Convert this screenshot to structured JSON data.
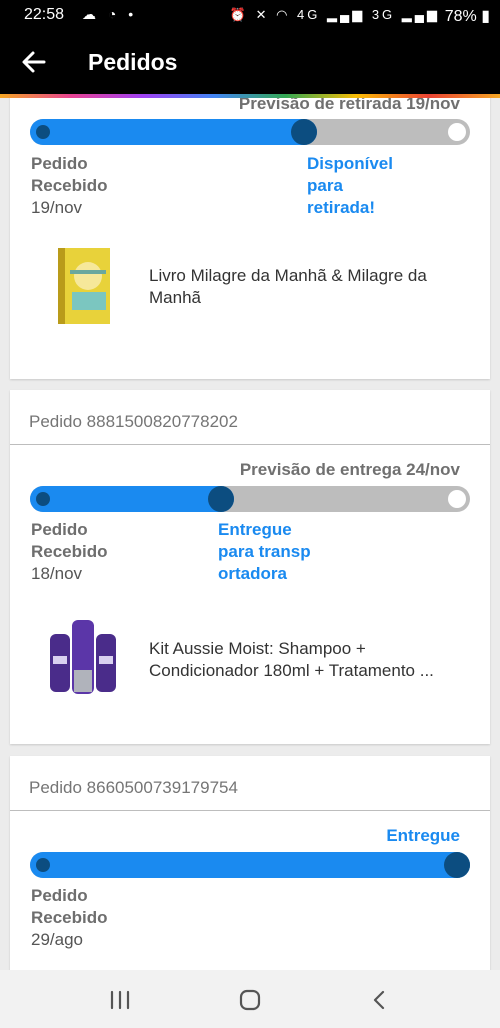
{
  "status_bar": {
    "time": "22:58",
    "left_icons": "☁ ◔ •",
    "right_icons": "⏰ ✕ ◠ 4G ▂▄▆ 3G ▂▄▆",
    "battery": "78%",
    "icon_names": [
      "data-saver-icon",
      "cloud-icon",
      "whatsapp-icon",
      "dot-icon",
      "alarm-icon",
      "mute-icon",
      "wifi-icon",
      "signal-4g-icon",
      "signal-3g-icon",
      "battery-icon"
    ]
  },
  "app_bar": {
    "title": "Pedidos",
    "back_icon": "arrow-left-icon"
  },
  "colors": {
    "accent": "#1a8af0",
    "track_done": "#1a8af0",
    "track_pending": "#bdbdbd",
    "dot": "#0c4d80",
    "app_bar": "#000000"
  },
  "orders": [
    {
      "estimate": "Previsão de retirada 19/nov",
      "progress": 0.63,
      "step_received": "Pedido Recebido",
      "step_date": "19/nov",
      "status": "Disponível para retirada!",
      "product": "Livro Milagre da Manhã & Milagre da Manhã"
    },
    {
      "order_id": "Pedido 8881500820778202",
      "estimate": "Previsão de entrega 24/nov",
      "progress": 0.43,
      "step_received": "Pedido Recebido",
      "step_date": "18/nov",
      "status": "Entregue para transp ortadora",
      "product": "Kit Aussie Moist: Shampoo + Condicionador 180ml + Tratamento ..."
    },
    {
      "order_id": "Pedido 8660500739179754",
      "estimate": "Entregue",
      "progress": 1.0,
      "step_received": "Pedido Recebido",
      "step_date": "29/ago"
    }
  ],
  "nav_bar": {
    "icons": [
      "recent-apps-icon",
      "home-icon",
      "back-icon"
    ]
  }
}
